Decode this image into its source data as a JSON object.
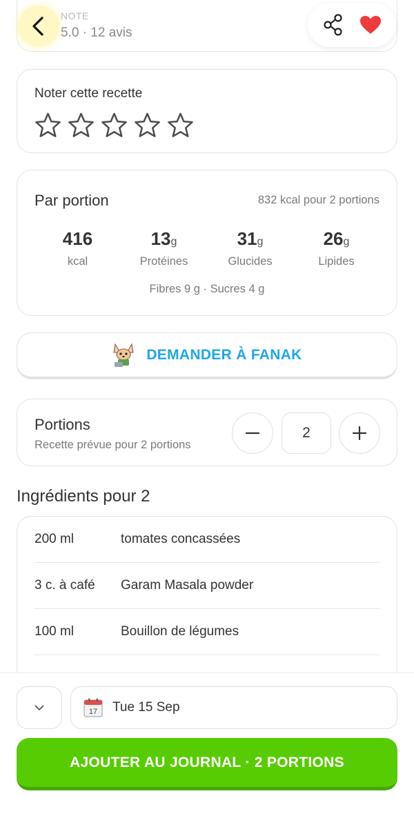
{
  "header": {
    "note_label": "NOTE",
    "note_value": "5.0 · 12 avis"
  },
  "rating": {
    "title": "Noter cette recette",
    "stars": 0,
    "max_stars": 5
  },
  "nutrition": {
    "title": "Par portion",
    "total": "832 kcal pour 2 portions",
    "macros": [
      {
        "value": "416",
        "unit": "",
        "label": "kcal"
      },
      {
        "value": "13",
        "unit": "g",
        "label": "Protéines"
      },
      {
        "value": "31",
        "unit": "g",
        "label": "Glucides"
      },
      {
        "value": "26",
        "unit": "g",
        "label": "Lipides"
      }
    ],
    "extra": "Fibres 9 g · Sucres 4 g"
  },
  "fanak": {
    "label": "DEMANDER À FANAK"
  },
  "portions": {
    "title": "Portions",
    "subtitle": "Recette prévue pour 2 portions",
    "value": "2"
  },
  "ingredients": {
    "title": "Ingrédients pour 2",
    "items": [
      {
        "qty": "200 ml",
        "name": "tomates concassées"
      },
      {
        "qty": "3 c. à café",
        "name": "Garam Masala powder"
      },
      {
        "qty": "100 ml",
        "name": "Bouillon de légumes"
      }
    ]
  },
  "bottom": {
    "date": "Tue 15 Sep",
    "calendar_day": "17",
    "add_label": "AJOUTER AU JOURNAL · 2 PORTIONS"
  },
  "colors": {
    "accent_blue": "#1ea7e8",
    "primary_green": "#58cc02",
    "heart_red": "#ef3b3b"
  }
}
